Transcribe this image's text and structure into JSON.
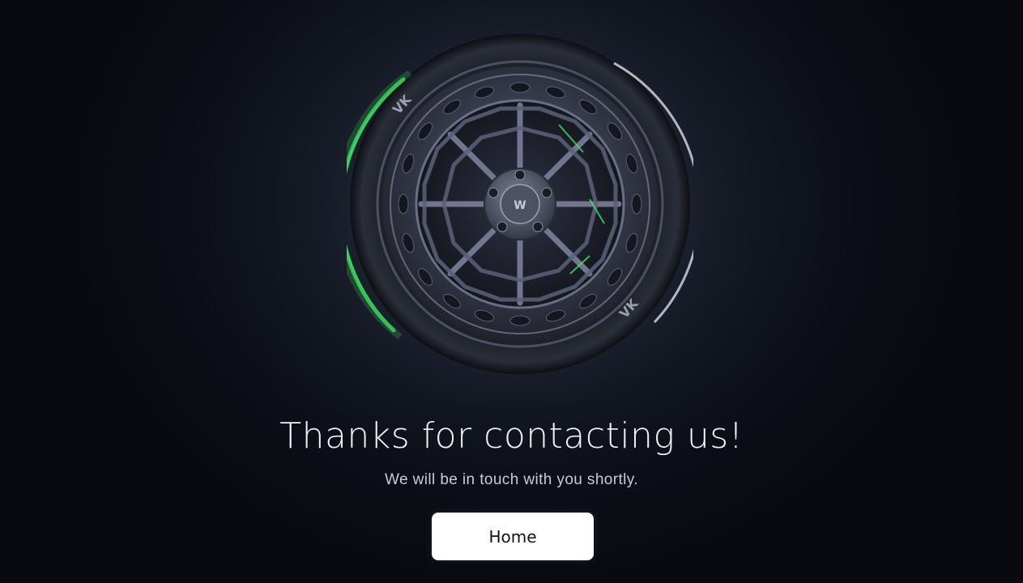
{
  "hero": {
    "image": "wheel-illustration",
    "accent_color": "#3ddc5a"
  },
  "message": {
    "title": "Thanks for contacting us!",
    "subtitle": "We will be in touch with you shortly."
  },
  "actions": {
    "home_label": "Home"
  }
}
